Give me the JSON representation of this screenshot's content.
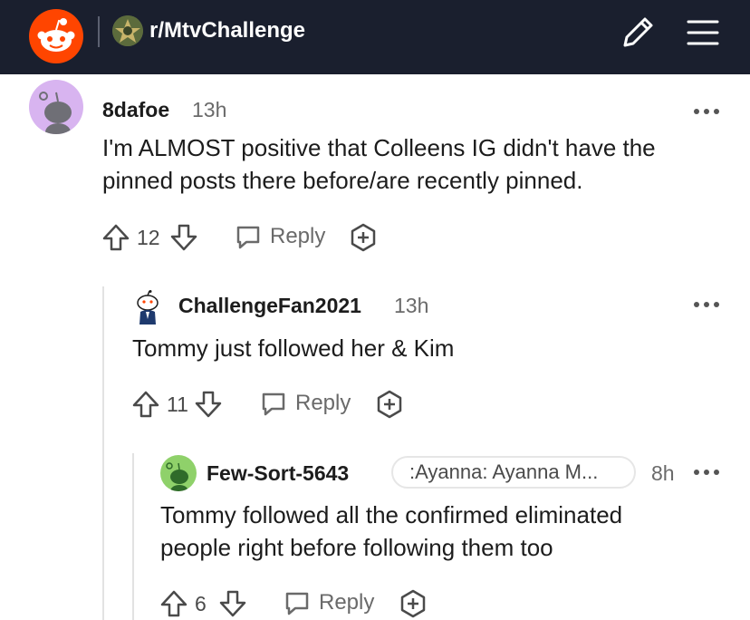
{
  "header": {
    "subreddit": "r/MtvChallenge",
    "background": "#1a1f2e",
    "brand_color": "#ff4500",
    "icons": [
      "reddit-logo-icon",
      "subreddit-icon",
      "edit-icon",
      "menu-icon"
    ]
  },
  "comments": [
    {
      "username": "8dafoe",
      "time": "13h",
      "text_lines": [
        "I'm ALMOST positive that Colleens IG didn't have the",
        "pinned posts there before/are recently pinned."
      ],
      "votes": "12",
      "reply_label": "Reply",
      "avatar_color": "#d8b4f0"
    },
    {
      "username": "ChallengeFan2021",
      "time": "13h",
      "text_lines": [
        "Tommy just followed her & Kim"
      ],
      "votes": "11",
      "reply_label": "Reply"
    },
    {
      "username": "Few-Sort-5643",
      "flair": ":Ayanna: Ayanna M...",
      "time": "8h",
      "text_lines": [
        "Tommy followed all the confirmed eliminated",
        "people right before following them too"
      ],
      "votes": "6",
      "reply_label": "Reply",
      "avatar_color": "#8fd16a"
    }
  ]
}
